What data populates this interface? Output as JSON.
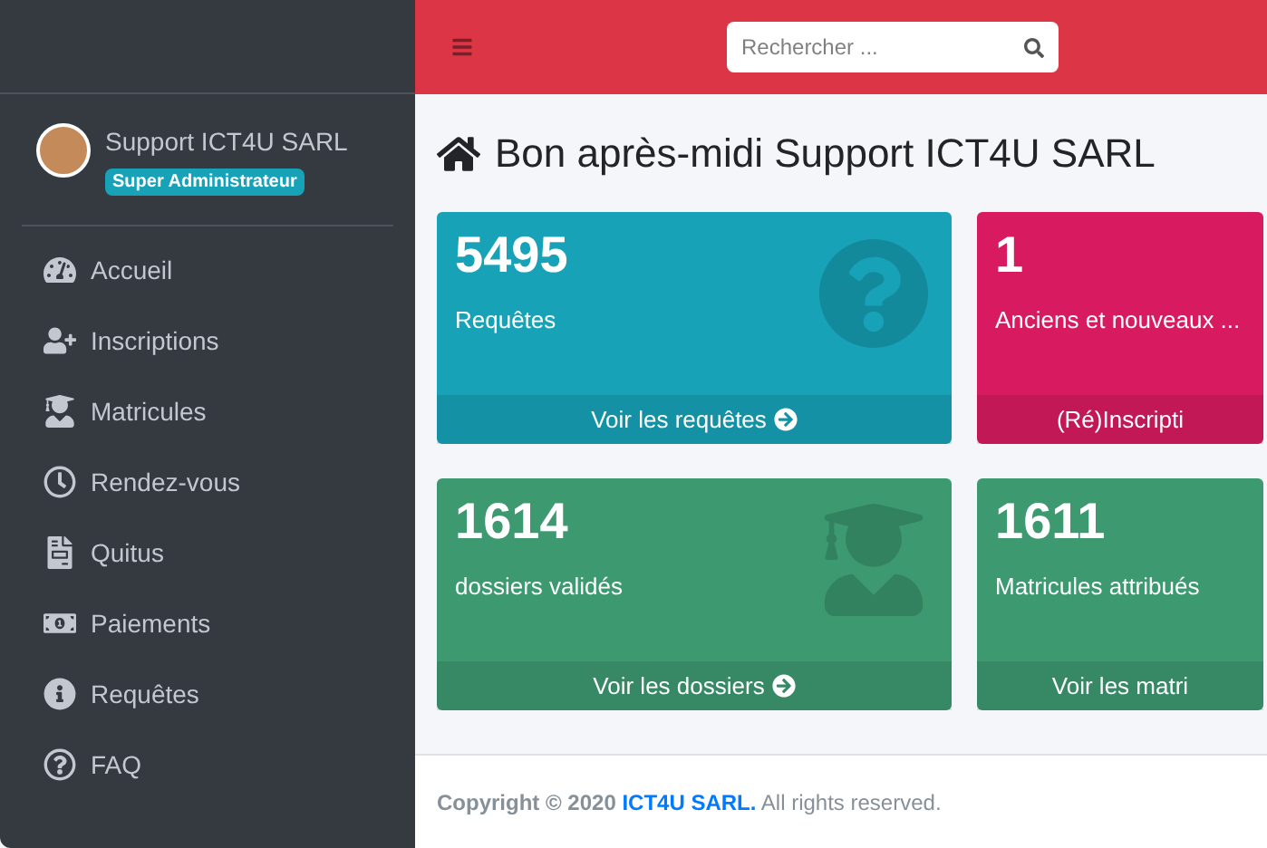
{
  "user": {
    "name": "Support ICT4U SARL",
    "role": "Super Administrateur"
  },
  "sidebar": {
    "items": [
      {
        "label": "Accueil"
      },
      {
        "label": "Inscriptions"
      },
      {
        "label": "Matricules"
      },
      {
        "label": "Rendez-vous"
      },
      {
        "label": "Quitus"
      },
      {
        "label": "Paiements"
      },
      {
        "label": "Requêtes"
      },
      {
        "label": "FAQ"
      }
    ]
  },
  "search": {
    "placeholder": "Rechercher ..."
  },
  "heading": "Bon après-midi Support ICT4U SARL",
  "cards": [
    {
      "value": "5495",
      "label": "Requêtes",
      "link": "Voir les requêtes",
      "color": "#17a2b8"
    },
    {
      "value": "1",
      "label": "Anciens et nouveaux ...",
      "link": "(Ré)Inscripti",
      "color": "#d81b60"
    },
    {
      "value": "1614",
      "label": "dossiers validés",
      "link": "Voir les dossiers",
      "color": "#3d9970"
    },
    {
      "value": "1611",
      "label": "Matricules attribués",
      "link": "Voir les matri",
      "color": "#3d9970"
    }
  ],
  "footer": {
    "prefix": "Copyright © 2020",
    "link": "ICT4U SARL.",
    "suffix": "All rights reserved."
  }
}
